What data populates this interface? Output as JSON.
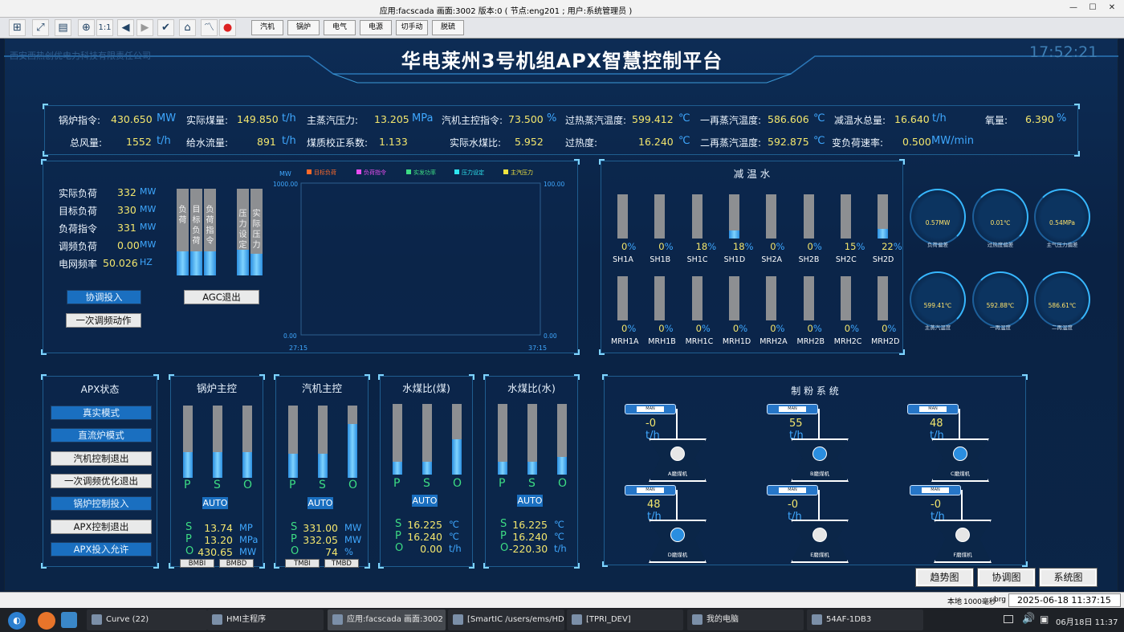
{
  "window": {
    "title": "应用:facscada  画面:3002  版本:0 ( 节点:eng201  ;  用户:系统管理员 )"
  },
  "toolbar": {
    "buttons": [
      "汽机",
      "锅炉",
      "电气",
      "电源",
      "切手动",
      "脱硫"
    ]
  },
  "header": {
    "title": "华电莱州3号机组APX智慧控制平台",
    "company": "西安西热创优电力科技有限责任公司",
    "clock": "17:52:21"
  },
  "summary": {
    "row1": [
      {
        "label": "锅炉指令:",
        "value": "430.650",
        "unit": "MW"
      },
      {
        "label": "实际煤量:",
        "value": "149.850",
        "unit": "t/h"
      },
      {
        "label": "主蒸汽压力:",
        "value": "13.205",
        "unit": "MPa"
      },
      {
        "label": "汽机主控指令:",
        "value": "73.500",
        "unit": "%"
      },
      {
        "label": "过热蒸汽温度:",
        "value": "599.412",
        "unit": "℃"
      },
      {
        "label": "一再蒸汽温度:",
        "value": "586.606",
        "unit": "℃"
      },
      {
        "label": "减温水总量:",
        "value": "16.640",
        "unit": "t/h"
      },
      {
        "label": "氧量:",
        "value": "6.390",
        "unit": "%"
      }
    ],
    "row2": [
      {
        "label": "总风量:",
        "value": "1552",
        "unit": "t/h"
      },
      {
        "label": "给水流量:",
        "value": "891",
        "unit": "t/h"
      },
      {
        "label": "煤质校正系数:",
        "value": "1.133",
        "unit": ""
      },
      {
        "label": "实际水煤比:",
        "value": "5.952",
        "unit": ""
      },
      {
        "label": "过热度:",
        "value": "16.240",
        "unit": "℃"
      },
      {
        "label": "二再蒸汽温度:",
        "value": "592.875",
        "unit": "℃"
      },
      {
        "label": "变负荷速率:",
        "value": "0.500",
        "unit": "MW/min"
      }
    ]
  },
  "load": {
    "items": [
      {
        "label": "实际负荷",
        "value": "332",
        "unit": "MW"
      },
      {
        "label": "目标负荷",
        "value": "330",
        "unit": "MW"
      },
      {
        "label": "负荷指令",
        "value": "331",
        "unit": "MW"
      },
      {
        "label": "调频负荷",
        "value": "0.00",
        "unit": "MW"
      },
      {
        "label": "电网频率",
        "value": "50.026",
        "unit": "HZ"
      }
    ],
    "buttons": {
      "coord": "协调投入",
      "primary": "一次调频动作",
      "agc": "AGC退出"
    },
    "bars": [
      {
        "label": "负荷",
        "level": 0.28
      },
      {
        "label": "目标负荷",
        "level": 0.28
      },
      {
        "label": "负荷指令",
        "level": 0.28
      },
      {
        "label": "压力设定",
        "level": 0.3
      },
      {
        "label": "实际压力",
        "level": 0.25
      }
    ]
  },
  "chart_data": {
    "type": "line",
    "ylabel": "MW",
    "ylim": [
      0,
      1000
    ],
    "y2lim": [
      0,
      100
    ],
    "yticks": [
      "1000.00",
      "0.00"
    ],
    "y2ticks": [
      "100.00",
      "0.00"
    ],
    "xticks": [
      "27:15",
      "37:15"
    ],
    "legend": [
      {
        "name": "目标负荷",
        "color": "#ff6a2a"
      },
      {
        "name": "负荷指令",
        "color": "#e84df0"
      },
      {
        "name": "实发功率",
        "color": "#3ddc84"
      },
      {
        "name": "压力设定",
        "color": "#2ee6f0"
      },
      {
        "name": "主汽压力",
        "color": "#f0e440"
      }
    ],
    "series": []
  },
  "desuper": {
    "title": "减 温 水",
    "row1": [
      {
        "name": "SH1A",
        "pct": "0",
        "level": 0
      },
      {
        "name": "SH1B",
        "pct": "0",
        "level": 0
      },
      {
        "name": "SH1C",
        "pct": "18",
        "level": 0
      },
      {
        "name": "SH1D",
        "pct": "18",
        "level": 0.18
      },
      {
        "name": "SH2A",
        "pct": "0",
        "level": 0
      },
      {
        "name": "SH2B",
        "pct": "0",
        "level": 0
      },
      {
        "name": "SH2C",
        "pct": "15",
        "level": 0
      },
      {
        "name": "SH2D",
        "pct": "22",
        "level": 0.22
      }
    ],
    "row2": [
      {
        "name": "MRH1A",
        "pct": "0",
        "level": 0
      },
      {
        "name": "MRH1B",
        "pct": "0",
        "level": 0
      },
      {
        "name": "MRH1C",
        "pct": "0",
        "level": 0
      },
      {
        "name": "MRH1D",
        "pct": "0",
        "level": 0
      },
      {
        "name": "MRH2A",
        "pct": "0",
        "level": 0
      },
      {
        "name": "MRH2B",
        "pct": "0",
        "level": 0
      },
      {
        "name": "MRH2C",
        "pct": "0",
        "level": 0
      },
      {
        "name": "MRH2D",
        "pct": "0",
        "level": 0
      }
    ]
  },
  "gauges": [
    {
      "value": "0.57MW",
      "caption": "负荷偏差"
    },
    {
      "value": "0.01℃",
      "caption": "过热度偏差"
    },
    {
      "value": "0.54MPa",
      "caption": "主气压力偏差"
    },
    {
      "value": "599.41℃",
      "caption": "主蒸汽温度"
    },
    {
      "value": "592.88℃",
      "caption": "一再温度"
    },
    {
      "value": "586.61℃",
      "caption": "二再温度"
    }
  ],
  "apx": {
    "title": "APX状态",
    "items": [
      {
        "label": "真实模式",
        "style": "blue"
      },
      {
        "label": "直流炉模式",
        "style": "blue"
      },
      {
        "label": "汽机控制退出",
        "style": "gray"
      },
      {
        "label": "一次调频优化退出",
        "style": "gray"
      },
      {
        "label": "锅炉控制投入",
        "style": "blue"
      },
      {
        "label": "APX控制退出",
        "style": "gray"
      },
      {
        "label": "APX投入允许",
        "style": "blue"
      }
    ]
  },
  "controls": [
    {
      "title": "锅炉主控",
      "psl": [
        "P",
        "S",
        "O"
      ],
      "levels": [
        0.36,
        0.36,
        0.36
      ],
      "auto": "AUTO",
      "rows": [
        {
          "k": "S",
          "v": "13.74",
          "u": "MP"
        },
        {
          "k": "P",
          "v": "13.20",
          "u": "MPa"
        },
        {
          "k": "O",
          "v": "430.65",
          "u": "MW"
        }
      ],
      "buttons": [
        "BMBI",
        "BMBD"
      ]
    },
    {
      "title": "汽机主控",
      "psl": [
        "P",
        "S",
        "O"
      ],
      "levels": [
        0.33,
        0.33,
        0.74
      ],
      "auto": "AUTO",
      "rows": [
        {
          "k": "S",
          "v": "331.00",
          "u": "MW"
        },
        {
          "k": "P",
          "v": "332.05",
          "u": "MW"
        },
        {
          "k": "O",
          "v": "74",
          "u": "%"
        }
      ],
      "buttons": [
        "TMBI",
        "TMBD"
      ]
    },
    {
      "title": "水煤比(煤)",
      "psl": [
        "P",
        "S",
        "O"
      ],
      "levels": [
        0.18,
        0.18,
        0.5
      ],
      "auto": "AUTO",
      "rows": [
        {
          "k": "S",
          "v": "16.225",
          "u": "℃"
        },
        {
          "k": "P",
          "v": "16.240",
          "u": "℃"
        },
        {
          "k": "O",
          "v": "0.00",
          "u": "t/h"
        }
      ],
      "buttons": []
    },
    {
      "title": "水煤比(水)",
      "psl": [
        "P",
        "S",
        "O"
      ],
      "levels": [
        0.18,
        0.18,
        0.25
      ],
      "auto": "AUTO",
      "rows": [
        {
          "k": "S",
          "v": "16.225",
          "u": "℃"
        },
        {
          "k": "P",
          "v": "16.240",
          "u": "℃"
        },
        {
          "k": "O",
          "v": "-220.30",
          "u": "t/h"
        }
      ],
      "buttons": []
    }
  ],
  "mills": {
    "title": "制  粉  系  统",
    "items": [
      {
        "flow": "-0",
        "unit": "t/h",
        "name": "A磨煤机",
        "running": false
      },
      {
        "flow": "55",
        "unit": "t/h",
        "name": "B磨煤机",
        "running": true
      },
      {
        "flow": "48",
        "unit": "t/h",
        "name": "C磨煤机",
        "running": true
      },
      {
        "flow": "48",
        "unit": "t/h",
        "name": "D磨煤机",
        "running": true
      },
      {
        "flow": "-0",
        "unit": "t/h",
        "name": "E磨煤机",
        "running": false
      },
      {
        "flow": "-0",
        "unit": "t/h",
        "name": "F磨煤机",
        "running": false
      }
    ]
  },
  "nav": {
    "trend": "趋势图",
    "coord": "协调图",
    "system": "系统图"
  },
  "status": {
    "local": "本地",
    "interval": "1000毫秒",
    "brg": "brg",
    "datetime": "2025-06-18  11:37:15"
  },
  "taskbar": {
    "tasks": [
      "Curve (22)",
      "HMI主程序",
      "应用:facscada  画面:3002 ...",
      "[SmartIC /users/ems/HD...",
      "[TPRI_DEV]",
      "我的电脑",
      "54AF-1DB3"
    ],
    "clock": "06月18日 11:37"
  }
}
